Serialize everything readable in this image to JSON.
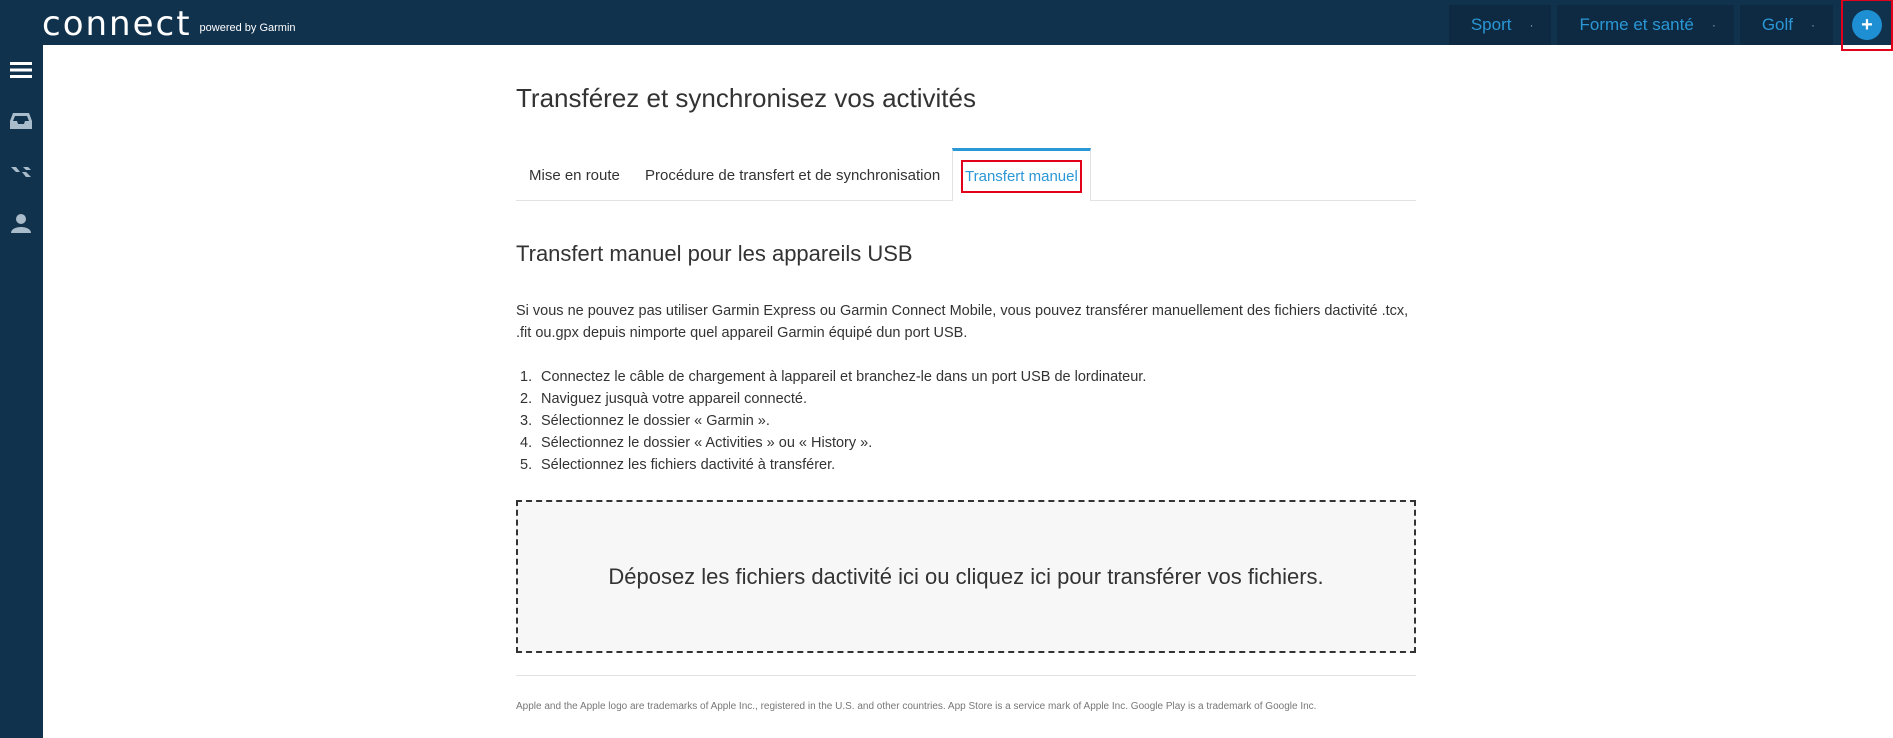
{
  "header": {
    "logo_word": "connect",
    "logo_sub": "powered by Garmin",
    "nav": [
      {
        "label": "Sport"
      },
      {
        "label": "Forme et santé"
      },
      {
        "label": "Golf"
      }
    ],
    "nav_separator": "·",
    "add_label": "+"
  },
  "sidebar": {
    "icons": [
      "menu-icon",
      "inbox-icon",
      "connections-icon",
      "user-icon"
    ]
  },
  "main": {
    "title": "Transférez et synchronisez vos activités",
    "tabs": [
      {
        "label": "Mise en route"
      },
      {
        "label": "Procédure de transfert et de synchronisation"
      },
      {
        "label": "Transfert manuel",
        "active": true
      }
    ],
    "section_title": "Transfert manuel pour les appareils USB",
    "intro": "Si vous ne pouvez pas utiliser Garmin Express ou Garmin Connect Mobile, vous pouvez transférer manuellement des fichiers dactivité .tcx, .fit ou.gpx depuis nimporte quel appareil Garmin équipé dun port USB.",
    "steps": [
      {
        "num": "1.",
        "text": "Connectez le câble de chargement à lappareil et branchez-le dans un port USB de lordinateur."
      },
      {
        "num": "2.",
        "text": "Naviguez jusquà votre appareil connecté."
      },
      {
        "num": "3.",
        "text": "Sélectionnez le dossier « Garmin »."
      },
      {
        "num": "4.",
        "text": "Sélectionnez le dossier « Activities » ou « History »."
      },
      {
        "num": "5.",
        "text": "Sélectionnez les fichiers dactivité à transférer."
      }
    ],
    "dropzone_text": "Déposez les fichiers dactivité ici ou cliquez ici pour transférer vos fichiers.",
    "footer_note": "Apple and the Apple logo are trademarks of Apple Inc., registered in the U.S. and other countries. App Store is a service mark of Apple Inc. Google Play is a trademark of Google Inc."
  },
  "colors": {
    "header_bg": "#11324d",
    "accent": "#2a97d6",
    "highlight": "#e3001b"
  }
}
